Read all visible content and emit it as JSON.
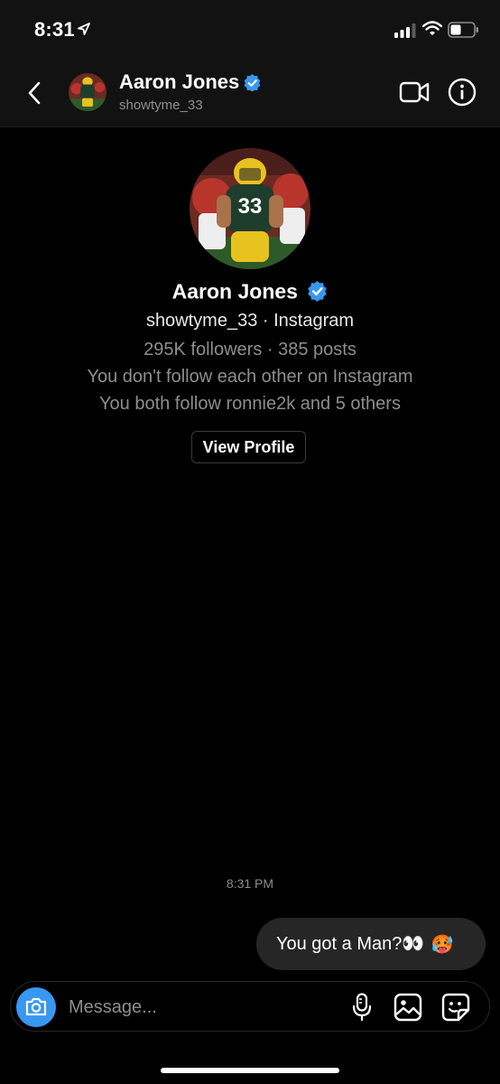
{
  "status_bar": {
    "time": "8:31"
  },
  "header": {
    "name": "Aaron Jones",
    "username": "showtyme_33"
  },
  "profile": {
    "name": "Aaron Jones",
    "handle_line": "showtyme_33 · Instagram",
    "stats": "295K followers · 385 posts",
    "follow_status": "You don't follow each other on Instagram",
    "mutuals": "You both follow ronnie2k and 5 others",
    "view_profile_label": "View Profile"
  },
  "conversation": {
    "timestamp": "8:31 PM",
    "messages": [
      {
        "text": "You got a Man?👀",
        "emoji": "🥵"
      }
    ]
  },
  "composer": {
    "placeholder": "Message..."
  },
  "colors": {
    "background": "#000000",
    "bar": "#121212",
    "bubble": "#262626",
    "accent_blue": "#3897f0",
    "muted_text": "#8e8e8e"
  },
  "icons": [
    "location-arrow-icon",
    "signal-icon",
    "wifi-icon",
    "battery-icon",
    "back-chevron-icon",
    "verified-badge-icon",
    "video-call-icon",
    "info-icon",
    "camera-icon",
    "microphone-icon",
    "gallery-icon",
    "sticker-icon"
  ]
}
